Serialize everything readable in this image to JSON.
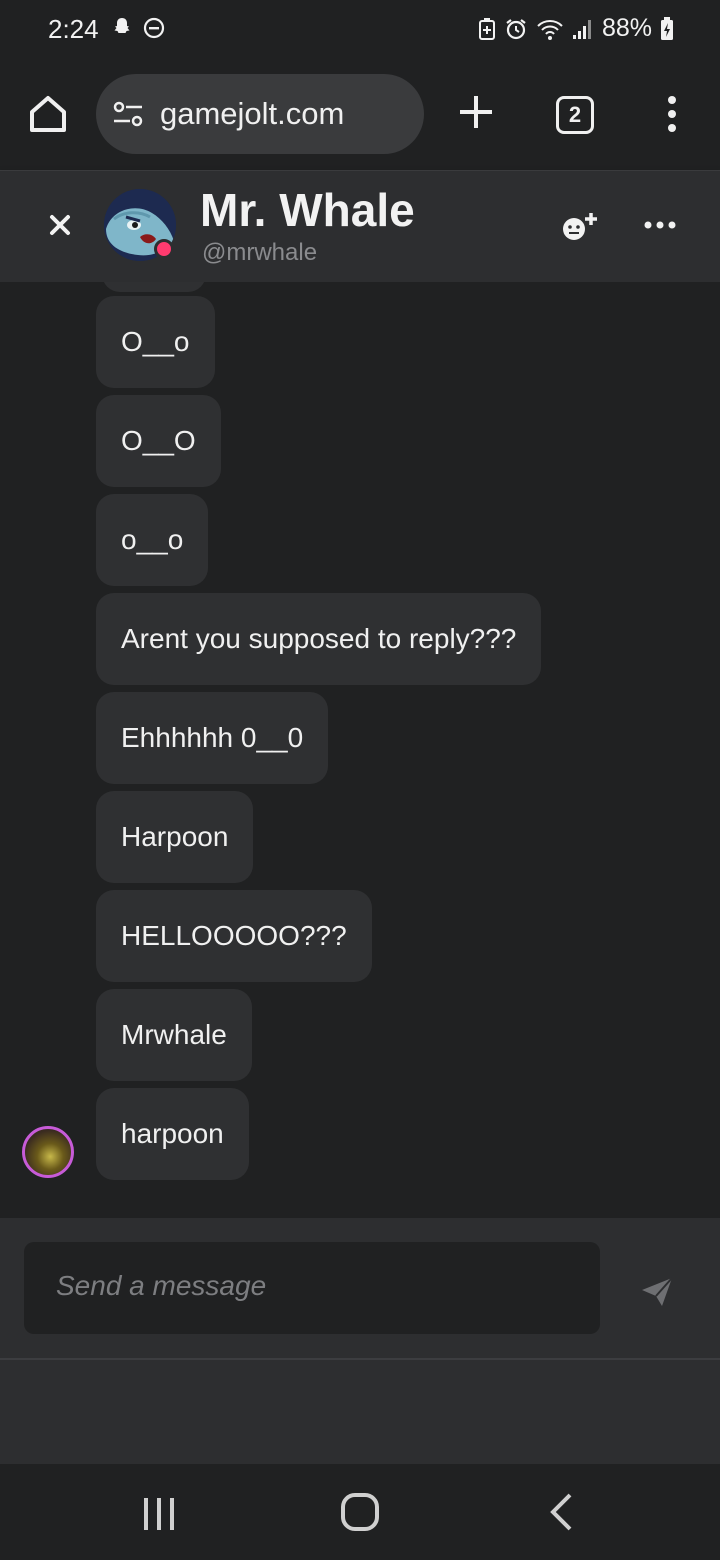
{
  "status_bar": {
    "time": "2:24",
    "battery": "88%",
    "left_icons": [
      "snapchat-icon",
      "do-not-disturb-icon"
    ],
    "right_icons": [
      "battery-saver-icon",
      "alarm-icon",
      "wifi-icon",
      "signal-icon",
      "battery-charging-icon"
    ]
  },
  "browser": {
    "url": "gamejolt.com",
    "tab_count": "2"
  },
  "chat": {
    "name": "Mr. Whale",
    "handle": "@mrwhale"
  },
  "messages": [
    {
      "text": "O__o"
    },
    {
      "text": "O__O"
    },
    {
      "text": "o__o"
    },
    {
      "text": "Arent you supposed to reply???"
    },
    {
      "text": "Ehhhhhh 0__0"
    },
    {
      "text": "Harpoon"
    },
    {
      "text": "HELLOOOOO???"
    },
    {
      "text": "Mrwhale"
    },
    {
      "text": "harpoon"
    }
  ],
  "composer": {
    "placeholder": "Send a message"
  },
  "colors": {
    "background": "#202122",
    "panel": "#2d2e30",
    "bubble": "#2f3032",
    "online": "#ff3b6f",
    "avatar_ring": "#c75bd8"
  }
}
